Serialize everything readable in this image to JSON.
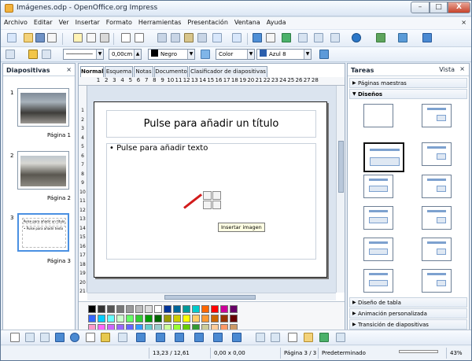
{
  "window": {
    "title": "Imágenes.odp - OpenOffice.org Impress",
    "min": "–",
    "max": "□",
    "close": "X"
  },
  "menu": {
    "items": [
      "Archivo",
      "Editar",
      "Ver",
      "Insertar",
      "Formato",
      "Herramientas",
      "Presentación",
      "Ventana",
      "Ayuda"
    ],
    "close": "×"
  },
  "toolbar2": {
    "line_width": "0,00cm",
    "color_name": "Negro",
    "fill_type": "Color",
    "fill_color": "Azul 8"
  },
  "slides_panel": {
    "title": "Diapositivas",
    "close": "×",
    "slides": [
      {
        "number": "1",
        "label": "Página 1"
      },
      {
        "number": "2",
        "label": "Página 2"
      },
      {
        "number": "3",
        "label": "Página 3"
      }
    ],
    "thumb3_title": "Pulse para añadir un título",
    "thumb3_text": "• Pulse para añadir texto"
  },
  "view_tabs": [
    "Normal",
    "Esquema",
    "Notas",
    "Documento",
    "Clasificador de diapositivas"
  ],
  "ruler_h": [
    "1",
    "2",
    "3",
    "4",
    "5",
    "6",
    "7",
    "8",
    "9",
    "10",
    "11",
    "12",
    "13",
    "14",
    "15",
    "16",
    "17",
    "18",
    "19",
    "20",
    "21",
    "22",
    "23",
    "24",
    "25",
    "26",
    "27",
    "28"
  ],
  "ruler_v": [
    "1",
    "2",
    "3",
    "4",
    "5",
    "6",
    "7",
    "8",
    "9",
    "10",
    "11",
    "12",
    "13",
    "14",
    "15",
    "16",
    "17",
    "18",
    "19",
    "20",
    "21"
  ],
  "slide": {
    "title_placeholder": "Pulse para añadir un título",
    "text_placeholder": "• Pulse para añadir texto",
    "tooltip": "Insertar imagen"
  },
  "tasks": {
    "title": "Tareas",
    "view_label": "Vista",
    "close": "×",
    "master_pages": "Páginas maestras",
    "designs": "Diseños",
    "table_design": "Diseño de tabla",
    "custom_animation": "Animación personalizada",
    "transition": "Transición de diapositivas"
  },
  "statusbar": {
    "position": "13,23 / 12,61",
    "size": "0,00 x 0,00",
    "page": "Página 3 / 3",
    "layout": "Predeterminado",
    "zoom": "43%"
  },
  "colors": {
    "accent": "#4a90e2",
    "window_bg": "#dfe8f3",
    "slide_bg": "#ffffff",
    "arrow": "#d21b1b",
    "tooltip_bg": "#ffffe3"
  }
}
